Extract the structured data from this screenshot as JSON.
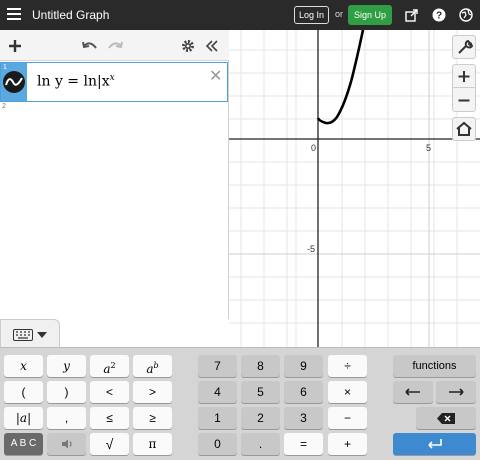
{
  "header": {
    "title": "Untitled Graph",
    "login_label": "Log In",
    "or_label": "or",
    "signup_label": "Sign Up",
    "icons": [
      "share-icon",
      "help-icon",
      "globe-icon"
    ]
  },
  "toolbar": {
    "icons": [
      "add-icon",
      "undo-icon",
      "redo-icon",
      "gear-icon",
      "collapse-icon"
    ]
  },
  "expressions": [
    {
      "index": "1",
      "text": "ln y = ln|x",
      "superscript": "x"
    },
    {
      "index": "2",
      "text": ""
    }
  ],
  "graph": {
    "x_ticks": [
      "0",
      "5"
    ],
    "y_ticks": [
      "-5"
    ],
    "tools": [
      "wrench-icon",
      "zoom-in-icon",
      "zoom-out-icon",
      "home-icon"
    ]
  },
  "keypad": {
    "left_rows": [
      [
        "x",
        "y",
        "a2",
        "ab"
      ],
      [
        "(",
        ")",
        "<",
        ">"
      ],
      [
        "|a|",
        ",",
        "≤",
        "≥"
      ],
      [
        "A B C",
        "speaker",
        "√",
        "π"
      ]
    ],
    "num_rows": [
      [
        "7",
        "8",
        "9",
        "÷"
      ],
      [
        "4",
        "5",
        "6",
        "×"
      ],
      [
        "1",
        "2",
        "3",
        "−"
      ],
      [
        "0",
        ".",
        "=",
        "+"
      ]
    ],
    "functions_label": "functions"
  },
  "colors": {
    "topbar": "#2a2a2a",
    "signup": "#2f9e44",
    "accent": "#5aa8e0",
    "enter": "#3d8ad1"
  }
}
